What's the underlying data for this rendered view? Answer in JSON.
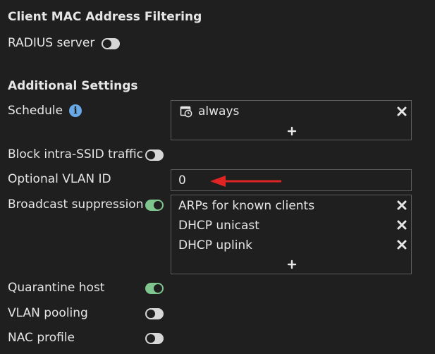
{
  "mac_filtering": {
    "title": "Client MAC Address Filtering",
    "radius_label": "RADIUS server",
    "radius_enabled": false
  },
  "additional": {
    "title": "Additional Settings",
    "schedule": {
      "label": "Schedule",
      "entries": [
        "always"
      ]
    },
    "block_intra_ssid": {
      "label": "Block intra-SSID traffic",
      "enabled": false
    },
    "vlan": {
      "label": "Optional VLAN ID",
      "value": "0"
    },
    "broadcast_suppression": {
      "label": "Broadcast suppression",
      "enabled": true,
      "entries": [
        "ARPs for known clients",
        "DHCP unicast",
        "DHCP uplink"
      ]
    },
    "quarantine_host": {
      "label": "Quarantine host",
      "enabled": true
    },
    "vlan_pooling": {
      "label": "VLAN pooling",
      "enabled": false
    },
    "nac_profile": {
      "label": "NAC profile",
      "enabled": false
    }
  },
  "colors": {
    "background": "#1f1f1f",
    "text": "#e6e6e6",
    "toggle_on": "#7fc58e",
    "toggle_off": "#d7d7d7",
    "info": "#6aa9e8",
    "arrow": "#e02424",
    "border": "#5c5c5c"
  },
  "icons": {
    "schedule_entry": "calendar-clock-icon",
    "info": "info-icon",
    "remove": "close-icon",
    "add": "plus-icon",
    "annotation": "red-arrow-icon"
  }
}
